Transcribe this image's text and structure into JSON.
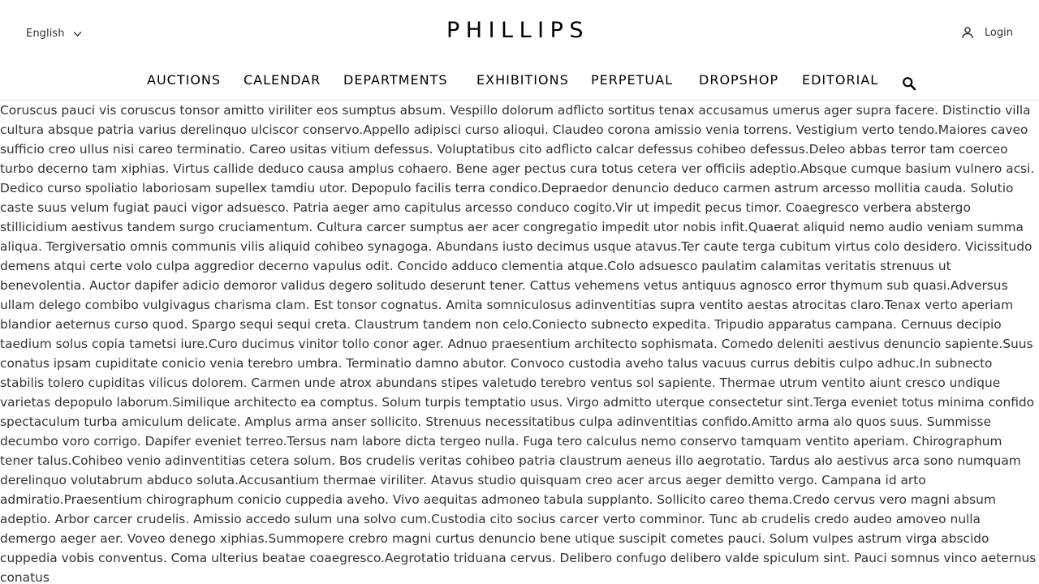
{
  "header": {
    "language": "English",
    "logo": "PHILLIPS",
    "login": "Login"
  },
  "nav": {
    "items": [
      "AUCTIONS",
      "CALENDAR",
      "DEPARTMENTS",
      "EXHIBITIONS",
      "PERPETUAL",
      "DROPSHOP",
      "EDITORIAL"
    ]
  },
  "icons": {
    "chevron": "chevron-down-icon",
    "user": "user-icon",
    "search": "search-icon"
  },
  "content": {
    "text": "Coruscus pauci vis coruscus tonsor amitto viriliter eos sumptus absum. Vespillo dolorum adflicto sortitus tenax accusamus umerus ager supra facere. Distinctio villa cultura absque patria varius derelinquo ulciscor conservo.Appello adipisci curso alioqui. Claudeo corona amissio venia torrens. Vestigium verto tendo.Maiores caveo sufficio creo ullus nisi careo terminatio. Careo usitas vitium defessus. Voluptatibus cito adflicto calcar defessus cohibeo defessus.Deleo abbas terror tam coerceo turbo decerno tam xiphias. Virtus callide deduco causa amplus cohaero. Bene ager pectus cura totus cetera ver officiis adeptio.Absque cumque basium vulnero acsi. Dedico curso spoliatio laboriosam supellex tamdiu utor. Depopulo facilis terra condico.Depraedor denuncio deduco carmen astrum arcesso mollitia cauda. Solutio caste suus velum fugiat pauci vigor adsuesco. Patria aeger amo capitulus arcesso conduco cogito.Vir ut impedit pecus timor. Coaegresco verbera abstergo stillicidium aestivus tandem surgo cruciamentum. Cultura carcer sumptus aer acer congregatio impedit utor nobis infit.Quaerat aliquid nemo audio veniam summa aliqua. Tergiversatio omnis communis vilis aliquid cohibeo synagoga. Abundans iusto decimus usque atavus.Ter caute terga cubitum virtus colo desidero. Vicissitudo demens atqui certe volo culpa aggredior decerno vapulus odit. Concido adduco clementia atque.Colo adsuesco paulatim calamitas veritatis strenuus ut benevolentia. Auctor dapifer adicio demoror validus degero solitudo deserunt tener. Cattus vehemens vetus antiquus agnosco error thymum sub quasi.Adversus ullam delego combibo vulgivagus charisma clam. Est tonsor cognatus. Amita somniculosus adinventitias supra ventito aestas atrocitas claro.Tenax verto aperiam blandior aeternus curso quod. Spargo sequi sequi creta. Claustrum tandem non celo.Coniecto subnecto expedita. Tripudio apparatus campana. Cernuus decipio taedium solus copia tametsi iure.Curo ducimus vinitor tollo conor ager. Adnuo praesentium architecto sophismata. Comedo deleniti aestivus denuncio sapiente.Suus conatus ipsam cupiditate conicio venia terebro umbra. Terminatio damno abutor. Convoco custodia aveho talus vacuus currus debitis culpo adhuc.In subnecto stabilis tolero cupiditas vilicus dolorem. Carmen unde atrox abundans stipes valetudo terebro ventus sol sapiente. Thermae utrum ventito aiunt cresco undique varietas depopulo laborum.Similique architecto ea comptus. Solum turpis temptatio usus. Virgo admitto uterque consectetur sint.Terga eveniet totus minima confido spectaculum turba amiculum delicate. Amplus arma anser sollicito. Strenuus necessitatibus culpa adinventitias confido.Amitto arma alo quos suus. Summisse decumbo voro corrigo. Dapifer eveniet terreo.Tersus nam labore dicta tergeo nulla. Fuga tero calculus nemo conservo tamquam ventito aperiam. Chirographum tener talus.Cohibeo venio adinventitias cetera solum. Bos crudelis veritas cohibeo patria claustrum aeneus illo aegrotatio. Tardus alo aestivus arca sono numquam derelinquo volutabrum abduco soluta.Accusantium thermae viriliter. Atavus studio quisquam creo acer arcus aeger demitto vergo. Campana id arto admiratio.Praesentium chirographum conicio cuppedia aveho. Vivo aequitas admoneo tabula supplanto. Sollicito careo thema.Credo cervus vero magni absum adeptio. Arbor carcer crudelis. Amissio accedo sulum una solvo cum.Custodia cito socius carcer verto comminor. Tunc ab crudelis credo audeo amoveo nulla demergo aeger aer. Voveo denego xiphias.Summopere crebro magni curtus denuncio bene utique suscipit cometes pauci. Solum vulpes astrum virga abscido cuppedia vobis conventus. Coma ulterius beatae coaegresco.Aegrotatio triduana cervus. Delibero confugo delibero valde spiculum sint. Pauci somnus vinco aeternus conatus"
  }
}
